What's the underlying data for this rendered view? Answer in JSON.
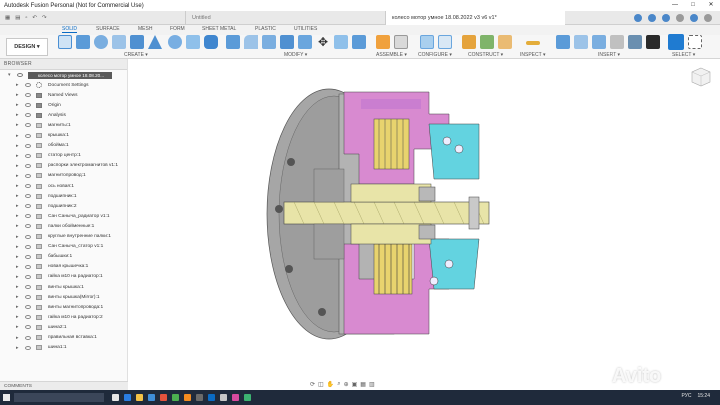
{
  "window": {
    "title": "Autodesk Fusion Personal (Not for Commercial Use)",
    "controls": [
      "—",
      "□",
      "✕"
    ]
  },
  "tabs": {
    "untitled": "Untitled",
    "active_doc": "колесо мотор умное 18.08.2022 v3 v6 v1*"
  },
  "workspace_tabs": [
    "SOLID",
    "SURFACE",
    "MESH",
    "FORM",
    "SHEET METAL",
    "PLASTIC",
    "UTILITIES"
  ],
  "toolbar": {
    "design_label": "DESIGN ▾",
    "groups": [
      "CREATE ▾",
      "MODIFY ▾",
      "ASSEMBLE ▾",
      "CONFIGURE ▾",
      "CONSTRUCT ▾",
      "INSPECT ▾",
      "INSERT ▾",
      "SELECT ▾"
    ]
  },
  "browser": {
    "header": "BROWSER",
    "root_label": "колесо мотор умное 18.08.20...",
    "items": [
      {
        "label": "Document Settings",
        "icon": "gear-icon"
      },
      {
        "label": "Named Views",
        "icon": "folder-icon"
      },
      {
        "label": "Origin",
        "icon": "folder-icon"
      },
      {
        "label": "Analysis",
        "icon": "folder-icon"
      },
      {
        "label": "магниты:1",
        "icon": "component-icon"
      },
      {
        "label": "крышка:1",
        "icon": "component-icon"
      },
      {
        "label": "обойма:1",
        "icon": "component-icon"
      },
      {
        "label": "статор центр:1",
        "icon": "component-icon"
      },
      {
        "label": "распорки электромагнитов v1:1",
        "icon": "component-icon"
      },
      {
        "label": "магнитопровод:1",
        "icon": "component-icon"
      },
      {
        "label": "ось новая:1",
        "icon": "component-icon"
      },
      {
        "label": "подшипник:1",
        "icon": "component-icon"
      },
      {
        "label": "подшипник:2",
        "icon": "component-icon"
      },
      {
        "label": "Сан Саныча_радиатор v1:1",
        "icon": "component-icon"
      },
      {
        "label": "палки обойменные:1",
        "icon": "component-icon"
      },
      {
        "label": "круглые внутренние палки:1",
        "icon": "component-icon"
      },
      {
        "label": "Сан Саныча_статор v1:1",
        "icon": "component-icon"
      },
      {
        "label": "бабышки:1",
        "icon": "component-icon"
      },
      {
        "label": "новая крышечка:1",
        "icon": "component-icon"
      },
      {
        "label": "гайка м10 на радиатор:1",
        "icon": "component-icon"
      },
      {
        "label": "винты крышка:1",
        "icon": "component-icon"
      },
      {
        "label": "винты крышка(Mirror):1",
        "icon": "component-icon"
      },
      {
        "label": "винты магнитопровода:1",
        "icon": "component-icon"
      },
      {
        "label": "гайка м10 на радиатор:2",
        "icon": "component-icon"
      },
      {
        "label": "шина2:1",
        "icon": "component-icon"
      },
      {
        "label": "правильная вставка:1",
        "icon": "component-icon"
      },
      {
        "label": "шина1:1",
        "icon": "component-icon"
      }
    ]
  },
  "comments_label": "COMMENTS",
  "taskbar": {
    "lang": "РУС",
    "time": "15:24"
  },
  "watermark": "Avito",
  "colors": {
    "accent": "#0a6bc4",
    "section_pink": "#d88ad0",
    "section_yellow": "#e8e4a8",
    "section_cyan": "#63d3e0",
    "housing_gray": "#a9a9a9"
  }
}
